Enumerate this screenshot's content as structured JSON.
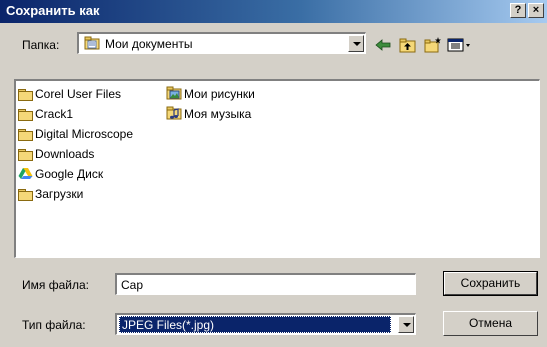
{
  "window": {
    "title": "Сохранить как"
  },
  "titlebar": {
    "help_label": "?",
    "close_label": "×"
  },
  "location": {
    "label": "Папка:",
    "value": "Мои документы"
  },
  "toolbar": {
    "back_icon": "back-arrow-icon",
    "up_icon": "up-folder-icon",
    "new_folder_icon": "new-folder-icon",
    "view_icon": "view-menu-icon"
  },
  "files": {
    "column1": [
      {
        "name": "Corel User Files",
        "icon": "folder-icon"
      },
      {
        "name": "Crack1",
        "icon": "folder-icon"
      },
      {
        "name": "Digital Microscope",
        "icon": "folder-icon"
      },
      {
        "name": "Downloads",
        "icon": "folder-icon"
      },
      {
        "name": "Google Диск",
        "icon": "google-drive-icon"
      },
      {
        "name": "Загрузки",
        "icon": "folder-icon"
      }
    ],
    "column2": [
      {
        "name": "Мои рисунки",
        "icon": "pictures-folder-icon"
      },
      {
        "name": "Моя музыка",
        "icon": "music-folder-icon"
      }
    ]
  },
  "filename": {
    "label": "Имя файла:",
    "value": "Cap"
  },
  "filetype": {
    "label": "Тип файла:",
    "value": "JPEG Files(*.jpg)"
  },
  "buttons": {
    "save": "Сохранить",
    "cancel": "Отмена"
  },
  "colors": {
    "title_start": "#0a246a",
    "title_end": "#a6caf0",
    "selection": "#0a246a",
    "dialog_bg": "#d4d0c8"
  }
}
